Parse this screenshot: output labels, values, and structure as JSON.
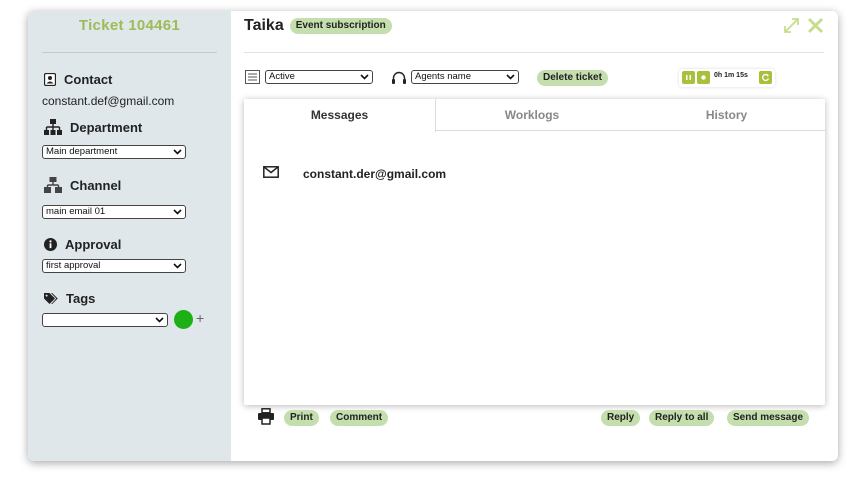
{
  "sidebar": {
    "ticket_title": "Ticket 104461",
    "contact": {
      "label": "Contact",
      "value": "constant.def@gmail.com",
      "icon": "contact-card-icon"
    },
    "department": {
      "label": "Department",
      "selected": "Main department",
      "icon": "org-chart-icon"
    },
    "channel": {
      "label": "Channel",
      "selected": "main email 01",
      "icon": "network-icon"
    },
    "approval": {
      "label": "Approval",
      "selected": "first approval",
      "icon": "info-circle-icon"
    },
    "tags": {
      "label": "Tags",
      "selected": "",
      "add_label": "+",
      "icon": "tags-icon"
    }
  },
  "header": {
    "title": "Taika",
    "badge": "Event subscription"
  },
  "toolbar": {
    "status_selected": "Active",
    "agent_selected": "Agents name",
    "delete_label": "Delete ticket",
    "timer_text": "0h 1m 15s"
  },
  "tabs": [
    {
      "label": "Messages",
      "active": true
    },
    {
      "label": "Worklogs",
      "active": false
    },
    {
      "label": "History",
      "active": false
    }
  ],
  "messages": [
    {
      "from": "constant.der@gmail.com",
      "icon": "envelope-icon"
    }
  ],
  "footer": {
    "print_label": "Print",
    "comment_label": "Comment",
    "reply_label": "Reply",
    "reply_all_label": "Reply to all",
    "send_label": "Send message"
  },
  "colors": {
    "accent": "#9dbb56",
    "pill": "#c4deae",
    "sidebar_bg": "#dfe7ea",
    "tag_dot": "#1db016",
    "timer_btn": "#a8c13c"
  }
}
